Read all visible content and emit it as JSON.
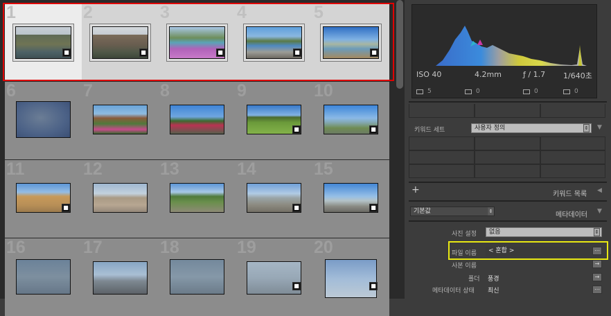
{
  "grid": {
    "cells": [
      {
        "num": "1",
        "selected": true,
        "badge_icon": "speech-bubble-icon"
      },
      {
        "num": "2",
        "selected": true,
        "badge_icon": "speech-bubble-icon"
      },
      {
        "num": "3",
        "selected": true,
        "badge_icon": "speech-bubble-icon"
      },
      {
        "num": "4",
        "selected": true,
        "badge_icon": "speech-bubble-icon"
      },
      {
        "num": "5",
        "selected": true,
        "badge_icon": "speech-bubble-icon"
      },
      {
        "num": "6",
        "selected": false,
        "badge_icon": "speech-bubble-icon"
      },
      {
        "num": "7",
        "selected": false,
        "badge_icon": "speech-bubble-icon"
      },
      {
        "num": "8",
        "selected": false,
        "badge_icon": "speech-bubble-icon"
      },
      {
        "num": "9",
        "selected": false,
        "badge_icon": "speech-bubble-icon"
      },
      {
        "num": "10",
        "selected": false,
        "badge_icon": "speech-bubble-icon"
      },
      {
        "num": "11",
        "selected": false,
        "badge_icon": "speech-bubble-icon"
      },
      {
        "num": "12",
        "selected": false,
        "badge_icon": "speech-bubble-icon"
      },
      {
        "num": "13",
        "selected": false,
        "badge_icon": "speech-bubble-icon"
      },
      {
        "num": "14",
        "selected": false,
        "badge_icon": "speech-bubble-icon"
      },
      {
        "num": "15",
        "selected": false,
        "badge_icon": "speech-bubble-icon"
      },
      {
        "num": "16",
        "selected": false,
        "badge_icon": "speech-bubble-icon"
      },
      {
        "num": "17",
        "selected": false,
        "badge_icon": "speech-bubble-icon"
      },
      {
        "num": "18",
        "selected": false,
        "badge_icon": "speech-bubble-icon"
      },
      {
        "num": "19",
        "selected": false,
        "badge_icon": "speech-bubble-icon"
      },
      {
        "num": "20",
        "selected": false,
        "badge_icon": "speech-bubble-icon"
      }
    ]
  },
  "histogram": {
    "iso": "ISO 40",
    "focal": "4.2mm",
    "aperture": "ƒ / 1.7",
    "shutter": "1/640초",
    "count_1": "5",
    "count_2": "0",
    "count_3": "0",
    "count_4": "0"
  },
  "keywords": {
    "set_label": "키워드 세트",
    "set_value": "사용자 정의",
    "list_label": "키워드 목록",
    "add_icon": "plus-icon"
  },
  "metadata": {
    "preset_value": "기본값",
    "panel_title": "메타데이터",
    "photo_setting_label": "사진 설정",
    "photo_setting_value": "없음",
    "filename_label": "파일 이름",
    "filename_value": "< 혼합 >",
    "copyname_label": "사본 이름",
    "folder_label": "폴더",
    "folder_value": "풍경",
    "status_label": "메타데이터 상태",
    "status_value": "최신"
  },
  "colors": {
    "selection_border": "#e00000",
    "highlight_border": "#e8e813"
  }
}
